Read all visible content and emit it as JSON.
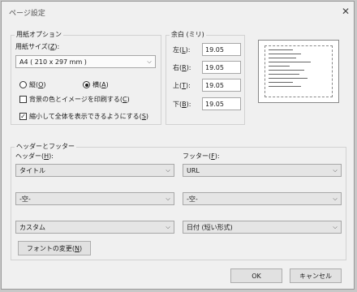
{
  "dialog": {
    "title": "ページ設定",
    "close_glyph": "✕"
  },
  "paper": {
    "group_label": "用紙オプション",
    "size_label": "用紙サイズ(",
    "size_key": "Z",
    "size_label_end": "):",
    "size_value": "A4 ( 210 x 297 mm )",
    "portrait": {
      "label": "縦(",
      "key": "O",
      "end": ")",
      "selected": false
    },
    "landscape": {
      "label": "横(",
      "key": "A",
      "end": ")",
      "selected": true
    },
    "print_bg": {
      "label": "背景の色とイメージを印刷する(",
      "key": "C",
      "end": ")",
      "checked": false
    },
    "shrink": {
      "label": "縮小して全体を表示できるようにする(",
      "key": "S",
      "end": ")",
      "checked": true
    },
    "check_mark": "✓"
  },
  "margins": {
    "group_label": "余白 (ミリ)",
    "left": {
      "label": "左(",
      "key": "L",
      "end": "):",
      "value": "19.05"
    },
    "right": {
      "label": "右(",
      "key": "R",
      "end": "):",
      "value": "19.05"
    },
    "top": {
      "label": "上(",
      "key": "T",
      "end": "):",
      "value": "19.05"
    },
    "bottom": {
      "label": "下(",
      "key": "B",
      "end": "):",
      "value": "19.05"
    }
  },
  "header_footer": {
    "group_label": "ヘッダーとフッター",
    "header_label": "ヘッダー(",
    "header_key": "H",
    "header_end": "):",
    "footer_label": "フッター(",
    "footer_key": "F",
    "footer_end": "):",
    "header_values": [
      "タイトル",
      "-空-",
      "カスタム"
    ],
    "footer_values": [
      "URL",
      "-空-",
      "日付 (短い形式)"
    ],
    "font_button": {
      "label": "フォントの変更(",
      "key": "N",
      "end": ")"
    }
  },
  "buttons": {
    "ok": "OK",
    "cancel": "キャンセル"
  },
  "icons": {
    "dropdown": "chevron-down-icon",
    "close": "close-icon"
  }
}
